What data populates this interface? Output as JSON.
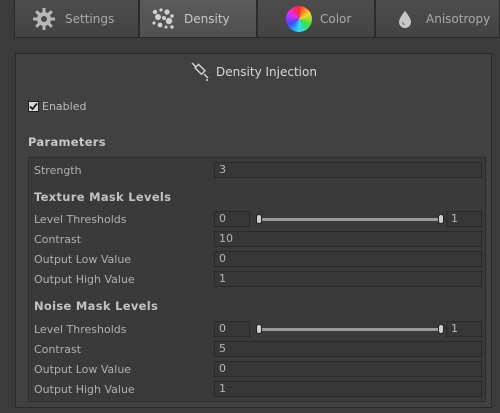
{
  "tabs": [
    {
      "label": "Settings",
      "icon": "gear-icon",
      "active": false
    },
    {
      "label": "Density",
      "icon": "density-cloud-icon",
      "active": true
    },
    {
      "label": "Color",
      "icon": "color-wheel-icon",
      "active": false
    },
    {
      "label": "Anisotropy",
      "icon": "droplet-icon",
      "active": false
    }
  ],
  "panel": {
    "title": "Density Injection",
    "title_icon": "syringe-icon",
    "enabled_label": "Enabled",
    "enabled": true,
    "parameters_title": "Parameters",
    "strength": {
      "label": "Strength",
      "value": "3"
    },
    "texture_mask": {
      "title": "Texture Mask Levels",
      "level_thresholds": {
        "label": "Level Thresholds",
        "min": "0",
        "max": "1"
      },
      "contrast": {
        "label": "Contrast",
        "value": "10"
      },
      "output_low": {
        "label": "Output Low Value",
        "value": "0"
      },
      "output_high": {
        "label": "Output High Value",
        "value": "1"
      }
    },
    "noise_mask": {
      "title": "Noise Mask Levels",
      "level_thresholds": {
        "label": "Level Thresholds",
        "min": "0",
        "max": "1"
      },
      "contrast": {
        "label": "Contrast",
        "value": "5"
      },
      "output_low": {
        "label": "Output Low Value",
        "value": "0"
      },
      "output_high": {
        "label": "Output High Value",
        "value": "1"
      }
    }
  },
  "colors": {
    "background": "#3b3b3b",
    "panel": "#414141",
    "field": "#373737"
  }
}
